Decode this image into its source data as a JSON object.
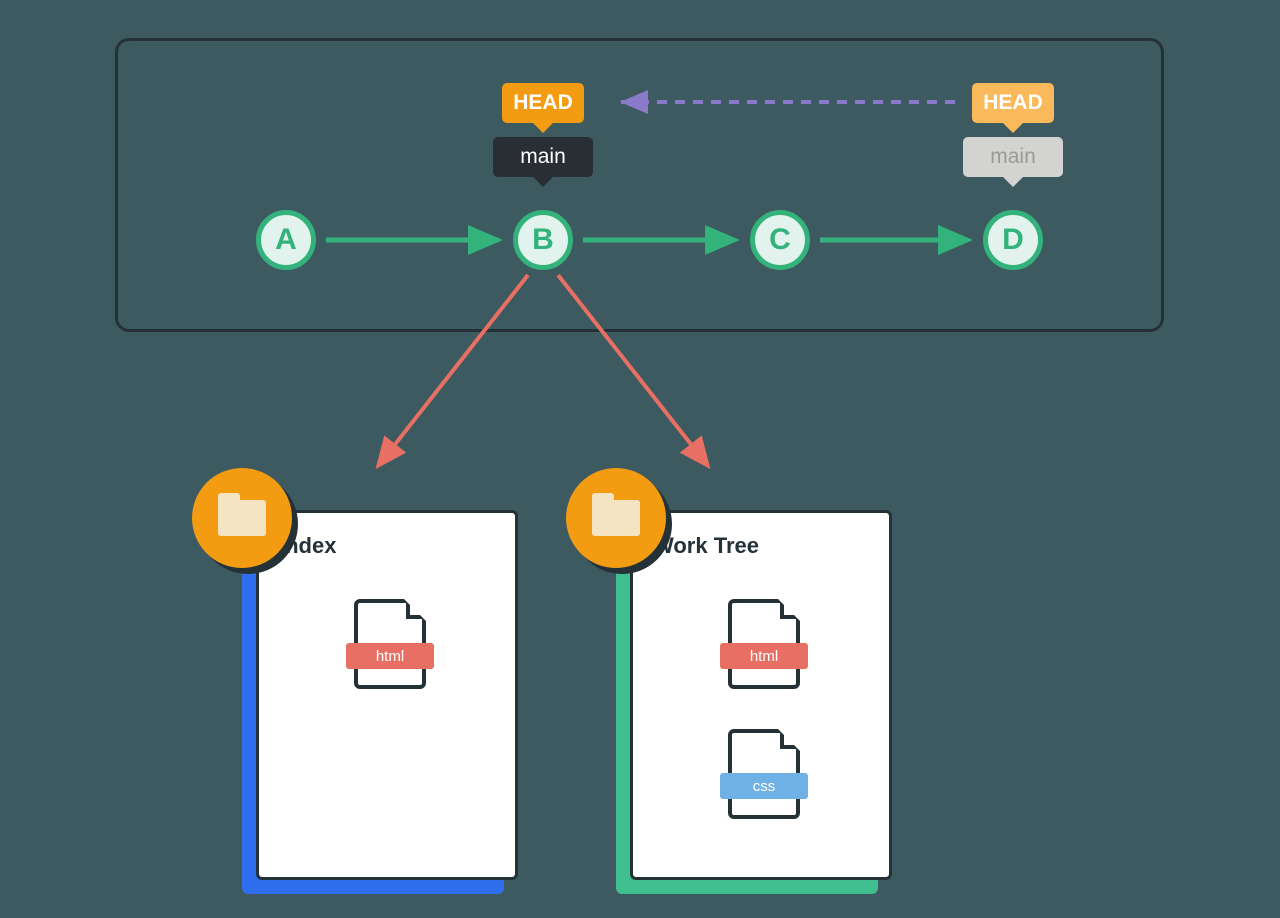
{
  "commits": {
    "a": "A",
    "b": "B",
    "c": "C",
    "d": "D"
  },
  "tags": {
    "head_active": "HEAD",
    "head_faded": "HEAD",
    "main_active": "main",
    "main_faded": "main"
  },
  "panels": {
    "index": {
      "title": "Index"
    },
    "worktree": {
      "title": "Work Tree"
    }
  },
  "files": {
    "html": "html",
    "css": "css"
  },
  "colors": {
    "green": "#34b27b",
    "orange": "#f39c12",
    "red": "#e86f63",
    "blue_panel": "#2f6fed",
    "green_panel": "#3fbf8f",
    "purple": "#8b79c9"
  }
}
